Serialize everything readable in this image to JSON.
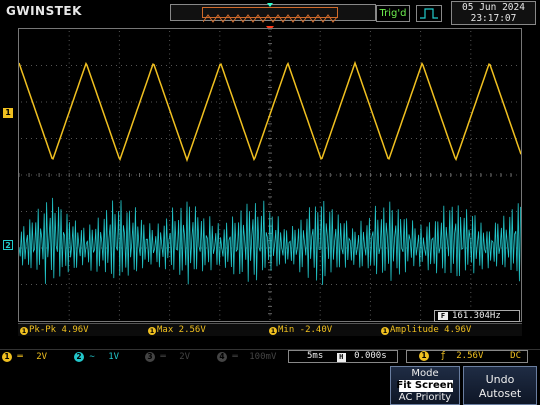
{
  "brand": "GWINSTEK",
  "header": {
    "trigger_status": "Trig'd",
    "trigger_edge": "rising-edge-icon",
    "date": "05 Jun 2024",
    "time": "23:17:07"
  },
  "display": {
    "ch1_marker": "1",
    "ch2_marker": "2",
    "frequency_icon": "F",
    "frequency": "161.304Hz"
  },
  "measurements": [
    {
      "source": "1",
      "label": "Pk-Pk 4.96V"
    },
    {
      "source": "1",
      "label": "Max 2.56V"
    },
    {
      "source": "1",
      "label": "Min -2.40V"
    },
    {
      "source": "1",
      "label": "Amplitude 4.96V"
    }
  ],
  "status_bar": {
    "ch1": {
      "num": "1",
      "coupling": "═",
      "scale": "2V"
    },
    "ch2": {
      "num": "2",
      "coupling": "∼",
      "scale": "1V"
    },
    "ch3": {
      "num": "3",
      "coupling": "═",
      "scale": "2V"
    },
    "ch4": {
      "num": "4",
      "coupling": "═",
      "scale": "100mV"
    },
    "timebase": "5ms",
    "h_icon": "H",
    "position": "0.000s",
    "trigger_source": "1",
    "trigger_slope": "ƒ",
    "trigger_level": "2.56V",
    "trigger_coupling": "DC"
  },
  "softkeys": {
    "mode_title": "Mode",
    "mode_selected": "Fit Screen",
    "mode_option": "AC Priority",
    "undo_line1": "Undo",
    "undo_line2": "Autoset"
  },
  "colors": {
    "ch1": "#f0c020",
    "ch2": "#22c8cc",
    "trigger_marker": "#ff3a1a",
    "trigd": "#6ef04f"
  }
}
